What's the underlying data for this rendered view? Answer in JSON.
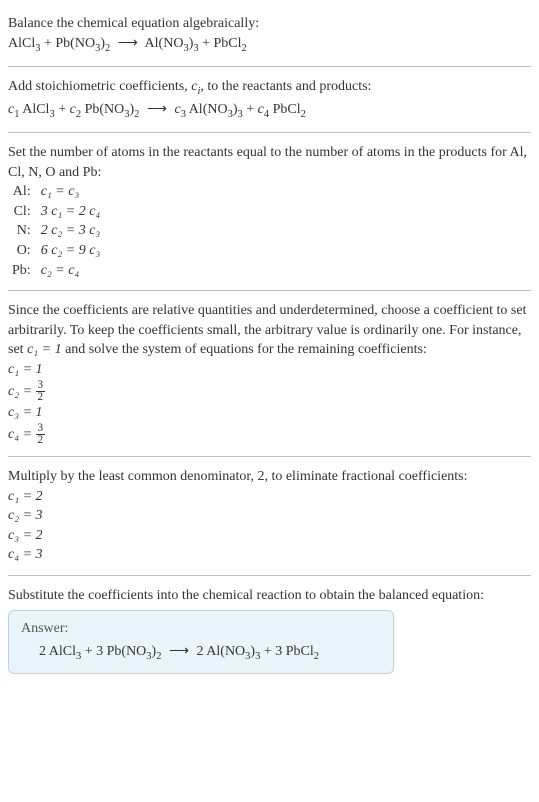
{
  "sections": {
    "balance_intro": "Balance the chemical equation algebraically:",
    "add_coeff_a": "Add stoichiometric coefficients, ",
    "add_coeff_b": ", to the reactants and products:",
    "set_atoms": "Set the number of atoms in the reactants equal to the number of atoms in the products for Al, Cl, N, O and Pb:",
    "since": "Since the coefficients are relative quantities and underdetermined, choose a coefficient to set arbitrarily. To keep the coefficients small, the arbitrary value is ordinarily one. For instance, set ",
    "since_b": " and solve the system of equations for the remaining coefficients:",
    "multiply": "Multiply by the least common denominator, 2, to eliminate fractional coefficients:",
    "substitute": "Substitute the coefficients into the chemical reaction to obtain the balanced equation:"
  },
  "equation_plain": {
    "r1": "AlCl",
    "r1sub": "3",
    "r2": "Pb(NO",
    "r2sub1": "3",
    "r2suf": ")",
    "r2sub2": "2",
    "p1": "Al(NO",
    "p1sub1": "3",
    "p1suf": ")",
    "p1sub2": "3",
    "p2": "PbCl",
    "p2sub": "2"
  },
  "c": {
    "c1": "c",
    "c1s": "1",
    "c2": "c",
    "c2s": "2",
    "c3": "c",
    "c3s": "3",
    "c4": "c",
    "c4s": "4",
    "ci": "c",
    "cis": "i"
  },
  "atom_rows": [
    {
      "el": "Al:",
      "eq": "c₁ = c₃"
    },
    {
      "el": "Cl:",
      "eq": "3 c₁ = 2 c₄"
    },
    {
      "el": "N:",
      "eq": "2 c₂ = 3 c₃"
    },
    {
      "el": "O:",
      "eq": "6 c₂ = 9 c₃"
    },
    {
      "el": "Pb:",
      "eq": "c₂ = c₄"
    }
  ],
  "set_c1": "c₁ = 1",
  "frac_results": {
    "l1": "c₁ = 1",
    "l2a": "c₂ = ",
    "l2num": "3",
    "l2den": "2",
    "l3": "c₃ = 1",
    "l4a": "c₄ = ",
    "l4num": "3",
    "l4den": "2"
  },
  "int_results": {
    "l1": "c₁ = 2",
    "l2": "c₂ = 3",
    "l3": "c₃ = 2",
    "l4": "c₄ = 3"
  },
  "answer": {
    "title": "Answer:",
    "coef1": "2 ",
    "coef2": "3 ",
    "coef3": "2 ",
    "coef4": "3 "
  },
  "arrow": "⟶",
  "plus": " + "
}
